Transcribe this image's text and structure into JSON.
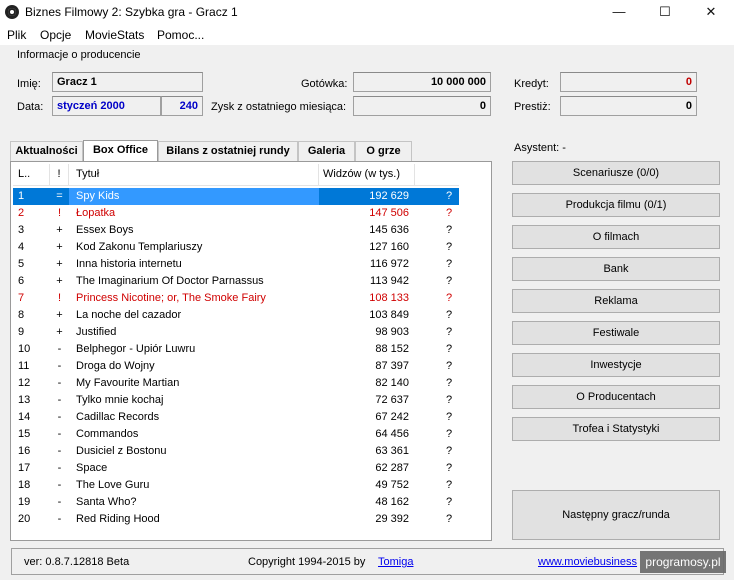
{
  "window": {
    "title": "Biznes Filmowy 2: Szybka gra - Gracz 1",
    "minimize": "—",
    "maximize": "☐",
    "close": "✕"
  },
  "menu": [
    "Plik",
    "Opcje",
    "MovieStats",
    "Pomoc..."
  ],
  "producer": {
    "group_label": "Informacje o producencie",
    "name_label": "Imię:",
    "name": "Gracz 1",
    "date_label": "Data:",
    "date": "styczeń 2000",
    "date_num": "240",
    "cash_label": "Gotówka:",
    "cash": "10 000 000",
    "profit_label": "Zysk z ostatniego miesiąca:",
    "profit": "0",
    "credit_label": "Kredyt:",
    "credit": "0",
    "prestige_label": "Prestiż:",
    "prestige": "0"
  },
  "tabs": [
    "Aktualności",
    "Box Office",
    "Bilans z ostatniej rundy",
    "Galeria",
    "O grze"
  ],
  "active_tab": 1,
  "table": {
    "headers": [
      "L..",
      "!",
      "Tytuł",
      "Widzów (w tys.)",
      ""
    ],
    "rows": [
      {
        "lp": "1",
        "mark": "=",
        "title": "Spy Kids",
        "views": "192 629",
        "q": "?",
        "red": false
      },
      {
        "lp": "2",
        "mark": "!",
        "title": "Łopatka",
        "views": "147 506",
        "q": "?",
        "red": true
      },
      {
        "lp": "3",
        "mark": "+",
        "title": "Essex Boys",
        "views": "145 636",
        "q": "?",
        "red": false
      },
      {
        "lp": "4",
        "mark": "+",
        "title": "Kod Zakonu Templariuszy",
        "views": "127 160",
        "q": "?",
        "red": false
      },
      {
        "lp": "5",
        "mark": "+",
        "title": "Inna historia internetu",
        "views": "116 972",
        "q": "?",
        "red": false
      },
      {
        "lp": "6",
        "mark": "+",
        "title": "The Imaginarium Of Doctor Parnassus",
        "views": "113 942",
        "q": "?",
        "red": false
      },
      {
        "lp": "7",
        "mark": "!",
        "title": "Princess Nicotine; or, The Smoke Fairy",
        "views": "108 133",
        "q": "?",
        "red": true
      },
      {
        "lp": "8",
        "mark": "+",
        "title": "La noche del cazador",
        "views": "103 849",
        "q": "?",
        "red": false
      },
      {
        "lp": "9",
        "mark": "+",
        "title": "Justified",
        "views": "98 903",
        "q": "?",
        "red": false
      },
      {
        "lp": "10",
        "mark": "-",
        "title": "Belphegor - Upiór Luwru",
        "views": "88 152",
        "q": "?",
        "red": false
      },
      {
        "lp": "11",
        "mark": "-",
        "title": "Droga do Wojny",
        "views": "87 397",
        "q": "?",
        "red": false
      },
      {
        "lp": "12",
        "mark": "-",
        "title": "My Favourite Martian",
        "views": "82 140",
        "q": "?",
        "red": false
      },
      {
        "lp": "13",
        "mark": "-",
        "title": "Tylko mnie kochaj",
        "views": "72 637",
        "q": "?",
        "red": false
      },
      {
        "lp": "14",
        "mark": "-",
        "title": "Cadillac Records",
        "views": "67 242",
        "q": "?",
        "red": false
      },
      {
        "lp": "15",
        "mark": "-",
        "title": "Commandos",
        "views": "64 456",
        "q": "?",
        "red": false
      },
      {
        "lp": "16",
        "mark": "-",
        "title": "Dusiciel z Bostonu",
        "views": "63 361",
        "q": "?",
        "red": false
      },
      {
        "lp": "17",
        "mark": "-",
        "title": "Space",
        "views": "62 287",
        "q": "?",
        "red": false
      },
      {
        "lp": "18",
        "mark": "-",
        "title": "The Love Guru",
        "views": "49 752",
        "q": "?",
        "red": false
      },
      {
        "lp": "19",
        "mark": "-",
        "title": "Santa Who?",
        "views": "48 162",
        "q": "?",
        "red": false
      },
      {
        "lp": "20",
        "mark": "-",
        "title": "Red Riding Hood",
        "views": "29 392",
        "q": "?",
        "red": false
      }
    ],
    "selected_row": 0
  },
  "assistant": {
    "label": "Asystent: -",
    "buttons": [
      "Scenariusze (0/0)",
      "Produkcja filmu (0/1)",
      "O filmach",
      "Bank",
      "Reklama",
      "Festiwale",
      "Inwestycje",
      "O Producentach",
      "Trofea i Statystyki"
    ],
    "next_button": "Następny gracz/runda"
  },
  "status": {
    "version": "ver: 0.8.7.12818 Beta",
    "copyright": "Copyright 1994-2015 by",
    "author": "Tomiga",
    "url": "www.moviebusiness"
  },
  "watermark": "programosy.pl",
  "colors": {
    "selection": "#0078d7",
    "selection_title": "#3399ff",
    "red_text": "#d00000",
    "blue_text": "#0000c8"
  }
}
